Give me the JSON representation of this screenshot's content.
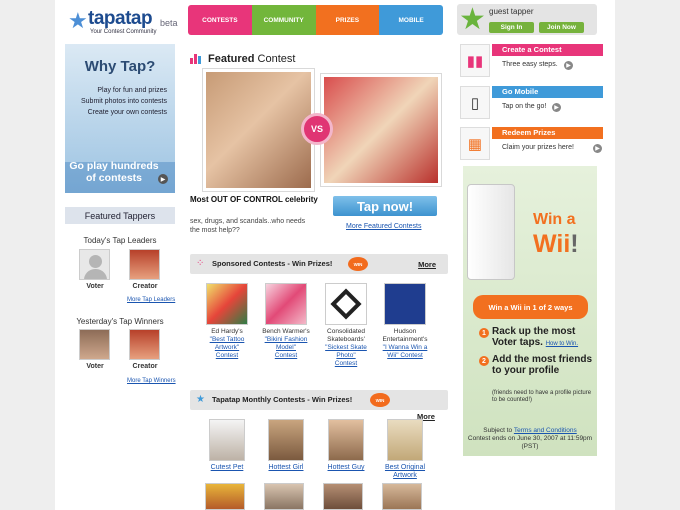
{
  "header": {
    "logo_name": "tapatap",
    "logo_beta": "beta",
    "logo_tagline": "Your Contest Community",
    "nav": [
      {
        "label": "CONTESTS",
        "color": "#e8357a"
      },
      {
        "label": "COMMUNITY",
        "color": "#72b63b"
      },
      {
        "label": "PRIZES",
        "color": "#f2701f"
      },
      {
        "label": "MOBILE",
        "color": "#3f9ad9"
      }
    ],
    "guest_name": "guest tapper",
    "sign_in": "Sign In",
    "join_now": "Join Now"
  },
  "why_tap": {
    "heading": "Why Tap?",
    "lines": [
      "Play for fun and prizes",
      "Submit photos into contests",
      "Create your own contests"
    ],
    "cta": "Go play hundreds of contests"
  },
  "featured_tappers": {
    "heading": "Featured Tappers",
    "today_heading": "Today's Tap Leaders",
    "today": [
      {
        "label": "Voter"
      },
      {
        "label": "Creator"
      }
    ],
    "today_more": "More Tap Leaders",
    "yesterday_heading": "Yesterday's Tap Winners",
    "yesterday": [
      {
        "label": "Voter"
      },
      {
        "label": "Creator"
      }
    ],
    "yesterday_more": "More Tap Winners"
  },
  "featured_contest": {
    "title_bold": "Featured",
    "title_rest": " Contest",
    "vs": "VS",
    "caption": "Most OUT OF CONTROL celebrity",
    "subcaption": "sex, drugs, and scandals..who needs the most help??",
    "tap_now": "Tap now!",
    "more_link": "More Featured Contests"
  },
  "sponsored": {
    "heading": "Sponsored Contests - Win Prizes!",
    "more": "More",
    "items": [
      {
        "sponsor": "Ed Hardy's",
        "contest": "\"Best Tattoo Artwork\"",
        "suffix": "Contest"
      },
      {
        "sponsor": "Bench Warmer's",
        "contest": "\"Bikini Fashion Model\"",
        "suffix": "Contest"
      },
      {
        "sponsor": "Consolidated Skateboards'",
        "contest": "\"Sickest Skate Photo\"",
        "suffix": "Contest"
      },
      {
        "sponsor": "Hudson Entertainment's",
        "contest": "\"I Wanna Win a Wii\" Contest",
        "suffix": ""
      }
    ]
  },
  "monthly": {
    "heading": "Tapatap Monthly Contests - Win Prizes!",
    "more": "More",
    "items": [
      {
        "label": "Cutest Pet"
      },
      {
        "label": "Hottest Girl"
      },
      {
        "label": "Hottest Guy"
      },
      {
        "label": "Best Original Artwork"
      }
    ]
  },
  "right": {
    "boxes": [
      {
        "title": "Create a Contest",
        "text": "Three easy steps.",
        "color": "#e8357a",
        "icon": "bar-chart-icon"
      },
      {
        "title": "Go Mobile",
        "text": "Tap on the go!",
        "color": "#3f9ad9",
        "icon": "phone-icon"
      },
      {
        "title": "Redeem Prizes",
        "text": "Claim your prizes here!",
        "color": "#f2701f",
        "icon": "gift-icon"
      }
    ],
    "wii": {
      "win_a": "Win a",
      "wii": "Wii",
      "exclaim": "!",
      "ways": "Win a Wii in 1 of 2 ways",
      "step1_num": "1",
      "step1": "Rack up the most Voter taps.",
      "step1_link": "How to Win.",
      "step2_num": "2",
      "step2": "Add the most friends to your profile",
      "step2_note": "(friends need to have a profile picture to be counted!)",
      "subject_to": "Subject to",
      "terms": "Terms and Conditions",
      "ends": "Contest ends on June 30, 2007 at 11:59pm (PST)"
    }
  }
}
